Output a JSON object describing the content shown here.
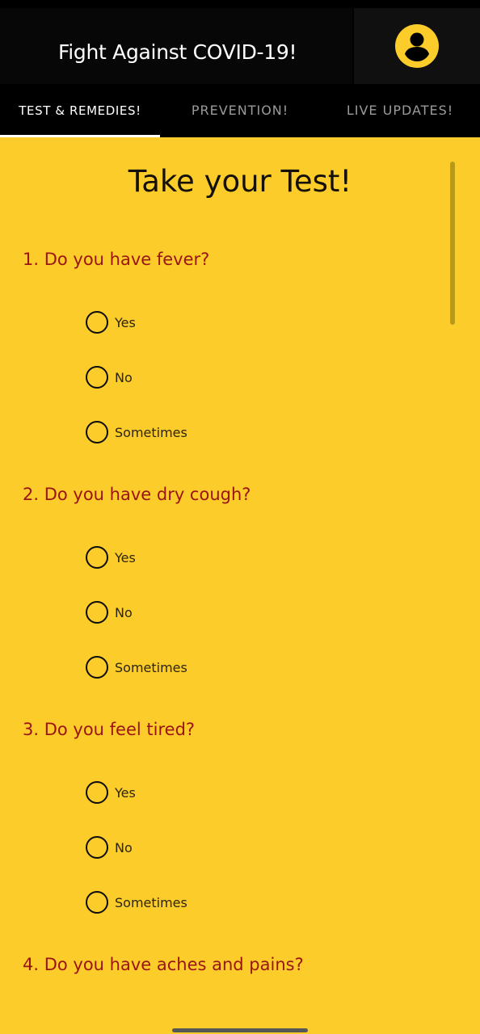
{
  "app_bar": {
    "title": "Fight Against COVID-19!",
    "profile_icon": "account-circle-icon",
    "profile_icon_color": "#fccd2a"
  },
  "tabs": [
    {
      "label": "TEST & REMEDIES!",
      "selected": true
    },
    {
      "label": "PREVENTION!",
      "selected": false
    },
    {
      "label": "LIVE UPDATES!",
      "selected": false
    }
  ],
  "colors": {
    "background": "#fccd2a",
    "app_bar": "#000000",
    "question_text": "#9b1414"
  },
  "test": {
    "heading": "Take your Test!",
    "questions": [
      {
        "text": "1. Do you have fever?",
        "options": [
          "Yes",
          "No",
          "Sometimes"
        ]
      },
      {
        "text": "2. Do you have dry cough?",
        "options": [
          "Yes",
          "No",
          "Sometimes"
        ]
      },
      {
        "text": "3. Do you feel tired?",
        "options": [
          "Yes",
          "No",
          "Sometimes"
        ]
      },
      {
        "text": "4. Do you have aches and pains?",
        "options": []
      }
    ]
  }
}
